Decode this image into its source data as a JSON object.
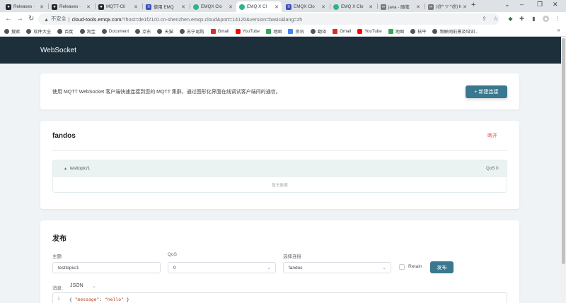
{
  "browser": {
    "tabs": [
      {
        "title": "Releases · ",
        "icon": "github-icon",
        "color": "#24292f",
        "active": false
      },
      {
        "title": "Releases · ",
        "icon": "github-icon",
        "color": "#24292f",
        "active": false
      },
      {
        "title": "MQTT-Cli",
        "icon": "github-icon",
        "color": "#24292f",
        "active": false
      },
      {
        "title": "使用 EMQ",
        "icon": "doc-icon",
        "color": "#3b4fb8",
        "active": false
      },
      {
        "title": "EMQX Clo",
        "icon": "emqx-icon",
        "color": "#2db48a",
        "active": false
      },
      {
        "title": "EMQ X Cl",
        "icon": "emqx-icon",
        "color": "#2db48a",
        "active": true
      },
      {
        "title": "EMQX Clo",
        "icon": "doc-icon",
        "color": "#3b4fb8",
        "active": false
      },
      {
        "title": "EMQ X Clo",
        "icon": "emqx-icon",
        "color": "#2db48a",
        "active": false
      },
      {
        "title": "java - 随笔",
        "icon": "link-icon",
        "color": "#555555",
        "active": false
      },
      {
        "title": "(@^ ▽ ^@) ki",
        "icon": "link-icon",
        "color": "#555555",
        "active": false
      }
    ],
    "address": {
      "security_label": "不安全",
      "url_host": "cloud-tools.emqx.com",
      "url_path": "/?host=de1f21c0.cn-shenzhen.emqx.cloud&port=14120&version=basic&lang=zh"
    },
    "bookmarks": [
      {
        "label": "搜索",
        "color": "#555555"
      },
      {
        "label": "软件大全",
        "color": "#555555"
      },
      {
        "label": "百度",
        "color": "#555555"
      },
      {
        "label": "淘宝",
        "color": "#555555"
      },
      {
        "label": "Document",
        "color": "#555555"
      },
      {
        "label": "京东",
        "color": "#555555"
      },
      {
        "label": "天猫",
        "color": "#555555"
      },
      {
        "label": "苏宁易购",
        "color": "#555555"
      },
      {
        "label": "Gmail",
        "color": "#d93025"
      },
      {
        "label": "YouTube",
        "color": "#ff0000"
      },
      {
        "label": "地图",
        "color": "#34a853"
      },
      {
        "label": "资讯",
        "color": "#4285f4"
      },
      {
        "label": "翻译",
        "color": "#555555"
      },
      {
        "label": "Gmail",
        "color": "#d93025"
      },
      {
        "label": "YouTube",
        "color": "#ff0000"
      },
      {
        "label": "地图",
        "color": "#34a853"
      },
      {
        "label": "核平",
        "color": "#555555"
      },
      {
        "label": "物联网前景及培训...",
        "color": "#555555"
      }
    ]
  },
  "app": {
    "title": "WebSocket",
    "intro": {
      "text": "使用 MQTT WebSocket 客户端快速连接到您的 MQTT 集群，通过图形化界面在线调试客户端间的通信。",
      "new_button": "+ 新建连接"
    },
    "connection": {
      "name": "fandos",
      "disconnect": "断开",
      "subscription": {
        "topic": "testtopic/1",
        "qos": "QoS 0"
      },
      "empty_text": "暂无数据"
    },
    "publish": {
      "title": "发布",
      "topic_label": "主题",
      "topic_value": "testtopic/1",
      "qos_label": "QoS",
      "qos_value": "0",
      "conn_label": "选择连接",
      "conn_value": "fandos",
      "retain_label": "Retain",
      "publish_button": "发布",
      "message_label": "消息:",
      "message_format": "JSON",
      "line_number": "1",
      "code_open": "{ ",
      "code_key": "\"message\"",
      "code_colon": ": ",
      "code_value": "\"hello\"",
      "code_close": " }"
    }
  },
  "colors": {
    "header_bg": "#1c2f3b",
    "accent": "#39788f",
    "danger": "#e45b4b",
    "subscription_bg": "#eaf3f2"
  }
}
